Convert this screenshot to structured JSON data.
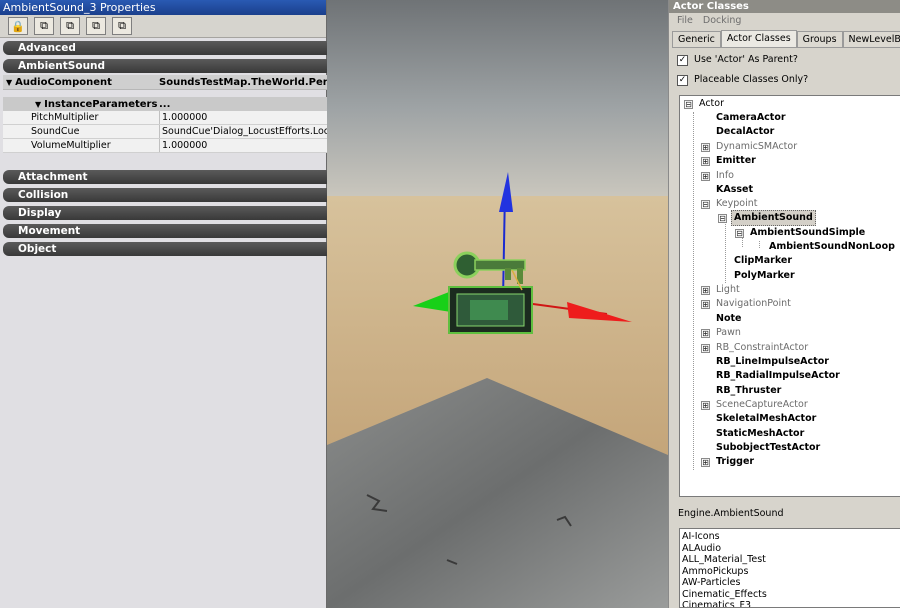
{
  "properties": {
    "title": "AmbientSound_3 Properties",
    "toolbar": {
      "icons": [
        "lock-icon",
        "copy-icon",
        "copy-icon",
        "copy-icon",
        "copy-icon"
      ],
      "glyphs": [
        "🔒",
        "⧉",
        "⧉",
        "⧉",
        "⧉"
      ]
    },
    "categories": {
      "advanced": "Advanced",
      "ambientsound": "AmbientSound",
      "attachment": "Attachment",
      "collision": "Collision",
      "display": "Display",
      "movement": "Movement",
      "object": "Object"
    },
    "audio_component": {
      "name": "AudioComponent",
      "value": "SoundsTestMap.TheWorld.Persist"
    },
    "instance_parameters": {
      "name": "InstanceParameters",
      "value": "..."
    },
    "rows": [
      {
        "name": "PitchMultiplier",
        "value": "1.000000"
      },
      {
        "name": "SoundCue",
        "value": "SoundCue'Dialog_LocustEfforts.Locust"
      },
      {
        "name": "VolumeMultiplier",
        "value": "1.000000"
      }
    ]
  },
  "actor_classes": {
    "title": "Actor Classes",
    "menu": [
      "File",
      "Docking"
    ],
    "tabs": [
      "Generic",
      "Actor Classes",
      "Groups",
      "NewLevelBrowse"
    ],
    "active_tab": "Actor Classes",
    "options": [
      {
        "label": "Use 'Actor' As Parent?",
        "checked": true
      },
      {
        "label": "Placeable Classes Only?",
        "checked": true
      }
    ],
    "tree": {
      "root": "Actor",
      "nodes": [
        {
          "label": "CameraActor"
        },
        {
          "label": "DecalActor"
        },
        {
          "label": "DynamicSMActor"
        },
        {
          "label": "Emitter"
        },
        {
          "label": "Info"
        },
        {
          "label": "KAsset"
        },
        {
          "label": "Keypoint"
        },
        {
          "label": "AmbientSound"
        },
        {
          "label": "AmbientSoundSimple"
        },
        {
          "label": "AmbientSoundNonLoop"
        },
        {
          "label": "ClipMarker"
        },
        {
          "label": "PolyMarker"
        },
        {
          "label": "Light"
        },
        {
          "label": "NavigationPoint"
        },
        {
          "label": "Note"
        },
        {
          "label": "Pawn"
        },
        {
          "label": "RB_ConstraintActor"
        },
        {
          "label": "RB_LineImpulseActor"
        },
        {
          "label": "RB_RadialImpulseActor"
        },
        {
          "label": "RB_Thruster"
        },
        {
          "label": "SceneCaptureActor"
        },
        {
          "label": "SkeletalMeshActor"
        },
        {
          "label": "StaticMeshActor"
        },
        {
          "label": "SubobjectTestActor"
        },
        {
          "label": "Trigger"
        }
      ]
    },
    "status": "Engine.AmbientSound",
    "packages": [
      "AI-Icons",
      "ALAudio",
      "ALL_Material_Test",
      "AmmoPickups",
      "AW-Particles",
      "Cinematic_Effects",
      "Cinematics_F3"
    ]
  },
  "colors": {
    "title_bar": "#1b3f8c",
    "category_bar": "#393939",
    "gizmo_x": "#e01818",
    "gizmo_y": "#10c010",
    "gizmo_z": "#1b2bd0",
    "sky": "#7e8487",
    "ground": "#c9ae84"
  },
  "toggles": {
    "collapsed": "⊞",
    "expanded": "⊟"
  }
}
